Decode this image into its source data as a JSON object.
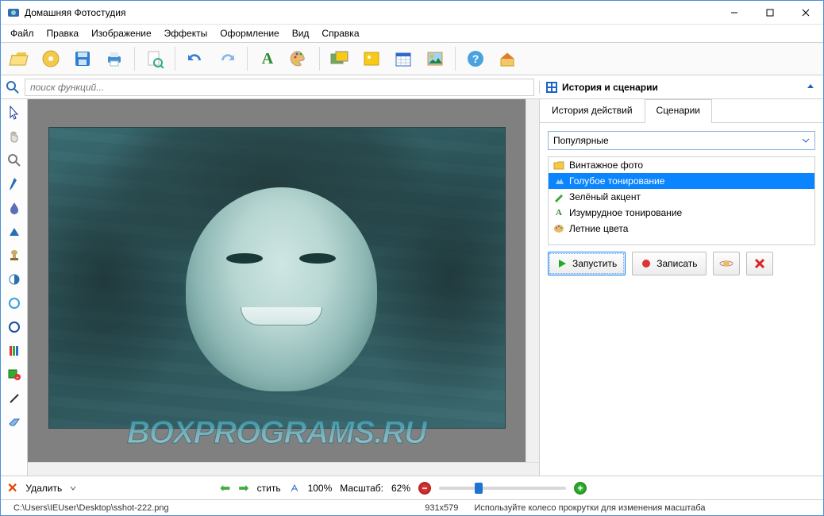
{
  "title": "Домашняя Фотостудия",
  "menu": [
    "Файл",
    "Правка",
    "Изображение",
    "Эффекты",
    "Оформление",
    "Вид",
    "Справка"
  ],
  "toolbar_icons": [
    "folder-open",
    "cd",
    "save",
    "print",
    "page-preview",
    "undo",
    "redo",
    "text",
    "palette",
    "image-pair",
    "image-single",
    "calendar",
    "scenery",
    "help",
    "home"
  ],
  "search": {
    "placeholder": "поиск функций..."
  },
  "history_panel_title": "История и сценарии",
  "tabs": {
    "history": "История действий",
    "scenarios": "Сценарии"
  },
  "dropdown_selected": "Популярные",
  "scenarios": [
    {
      "icon": "folder",
      "label": "Винтажное фото",
      "selected": false
    },
    {
      "icon": "triangles",
      "label": "Голубое тонирование",
      "selected": true
    },
    {
      "icon": "pencil",
      "label": "Зелёный акцент",
      "selected": false
    },
    {
      "icon": "A",
      "label": "Изумрудное тонирование",
      "selected": false
    },
    {
      "icon": "palette",
      "label": "Летние цвета",
      "selected": false
    }
  ],
  "actions": {
    "run": "Запустить",
    "record": "Записать"
  },
  "bottom": {
    "delete": "Удалить",
    "fit": "стить",
    "zoom_label_a": "100%",
    "zoom_label_b": "Масштаб:",
    "zoom_value": "62%"
  },
  "status": {
    "path": "C:\\Users\\IEUser\\Desktop\\sshot-222.png",
    "dims": "931x579",
    "hint": "Используйте колесо прокрутки для изменения масштаба"
  },
  "watermark": "BOXPROGRAMS.RU",
  "tool_icons": [
    "cursor",
    "hand",
    "zoom",
    "dropper-blue",
    "drop",
    "triangle",
    "stamp",
    "contrast",
    "circle-blue",
    "circle-darkblue",
    "bars",
    "rect-plus",
    "line",
    "eraser"
  ]
}
